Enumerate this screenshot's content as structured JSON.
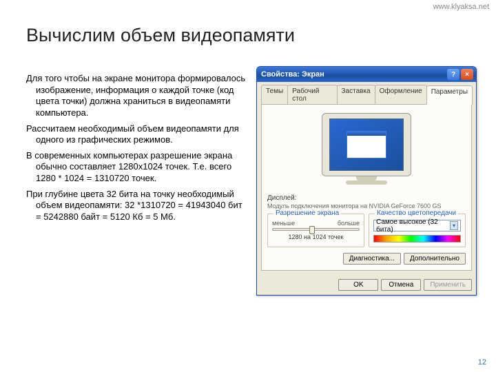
{
  "watermark": "www.klyaksa.net",
  "slide_title": "Вычислим объем видеопамяти",
  "page_number": "12",
  "paragraphs": {
    "p1": "Для того чтобы на экране монитора формировалось изображение, информация о каждой точке (код цвета точки) должна храниться в видеопамяти компьютера.",
    "p2": "Рассчитаем необходимый объем видеопамяти для одного из графических режимов.",
    "p3": "В современных компьютерах разрешение экрана обычно составляет 1280х1024 точек. Т.е. всего 1280 * 1024 = 1310720 точек.",
    "p4": "При глубине цвета 32 бита на точку необходимый объем видеопамяти: 32 *1310720 = 41943040 бит = 5242880 байт = 5120 Кб = 5 Мб."
  },
  "dialog": {
    "title": "Свойства: Экран",
    "tabs": {
      "t1": "Темы",
      "t2": "Рабочий стол",
      "t3": "Заставка",
      "t4": "Оформление",
      "t5": "Параметры"
    },
    "display_label": "Дисплей:",
    "display_info": "Модуль подключения монитора на NVIDIA GeForce 7600 GS",
    "res_group": "Разрешение экрана",
    "res_less": "меньше",
    "res_more": "больше",
    "res_value": "1280 на 1024 точек",
    "color_group": "Качество цветопередачи",
    "color_value": "Самое высокое (32 бита)",
    "btn_diag": "Диагностика...",
    "btn_adv": "Дополнительно",
    "btn_ok": "OK",
    "btn_cancel": "Отмена",
    "btn_apply": "Применить"
  }
}
